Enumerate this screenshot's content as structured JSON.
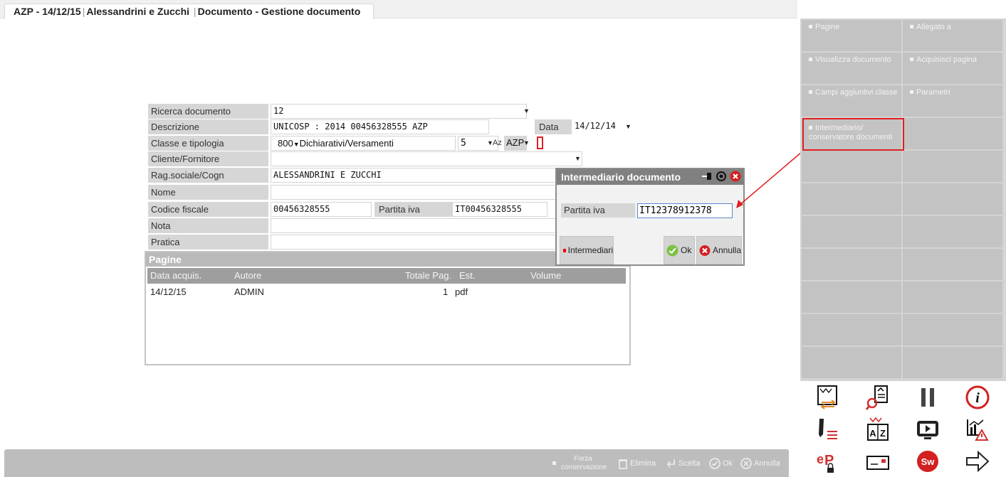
{
  "window": {
    "company_code": "AZP - 14/12/15",
    "company_name": "Alessandrini e Zucchi",
    "page_title": "Documento - Gestione documento"
  },
  "form": {
    "ricerca": {
      "label": "Ricerca documento",
      "value": "12"
    },
    "descrizione": {
      "label": "Descrizione",
      "value": "UNICOSP : 2014 00456328555 AZP"
    },
    "data": {
      "label": "Data",
      "value": "14/12/14"
    },
    "classe": {
      "label": "Classe e tipologia",
      "code": "800",
      "desc": "Dichiarativi/Versamenti",
      "tip": "5",
      "az_label": "Az",
      "az_value": "AZP"
    },
    "cliente": {
      "label": "Cliente/Fornitore",
      "value": ""
    },
    "ragsoc": {
      "label": "Rag.sociale/Cogn",
      "value": "ALESSANDRINI E ZUCCHI"
    },
    "nome": {
      "label": "Nome",
      "value": ""
    },
    "codfisc": {
      "label": "Codice fiscale",
      "value": "00456328555"
    },
    "piva": {
      "label": "Partita iva",
      "value": "IT00456328555"
    },
    "nota": {
      "label": "Nota",
      "value": ""
    },
    "pratica": {
      "label": "Pratica",
      "value": ""
    }
  },
  "pagine": {
    "title": "Pagine",
    "columns": [
      "Data acquis.",
      "Autore",
      "Totale Pag.",
      "Est.",
      "Volume"
    ],
    "rows": [
      {
        "data": "14/12/15",
        "autore": "ADMIN",
        "totale": "1",
        "est": "pdf",
        "volume": ""
      }
    ]
  },
  "dialog": {
    "title": "Intermediario documento",
    "piva_label": "Partita iva",
    "piva_value": "IT12378912378",
    "intermediari": "Intermediari",
    "ok": "Ok",
    "annulla": "Annulla"
  },
  "panel": {
    "buttons": [
      {
        "label": "Pagine"
      },
      {
        "label": "Allegato a"
      },
      {
        "label": "Visualizza documento"
      },
      {
        "label": "Acquisisci pagina"
      },
      {
        "label": "Campi aggiuntivi classe"
      },
      {
        "label": "Parametri"
      },
      {
        "label": "Intermediario/ conservatore documenti"
      }
    ]
  },
  "bottombar": {
    "forza": "Forza conservazione",
    "elimina": "Elimina",
    "scelta": "Scelta",
    "ok": "Ok",
    "annulla": "Annulla"
  },
  "icons": [
    "transfer-icon",
    "search-page-icon",
    "pause-icon",
    "info-icon",
    "edit-list-icon",
    "sort-az-icon",
    "play-icon",
    "chart-warning-icon",
    "ep-lock-icon",
    "card-icon",
    "sw-icon",
    "arrow-right-icon"
  ],
  "colors": {
    "accent_red": "#e02020",
    "panel_gray": "#c3c3c3",
    "dialog_title": "#808080"
  }
}
